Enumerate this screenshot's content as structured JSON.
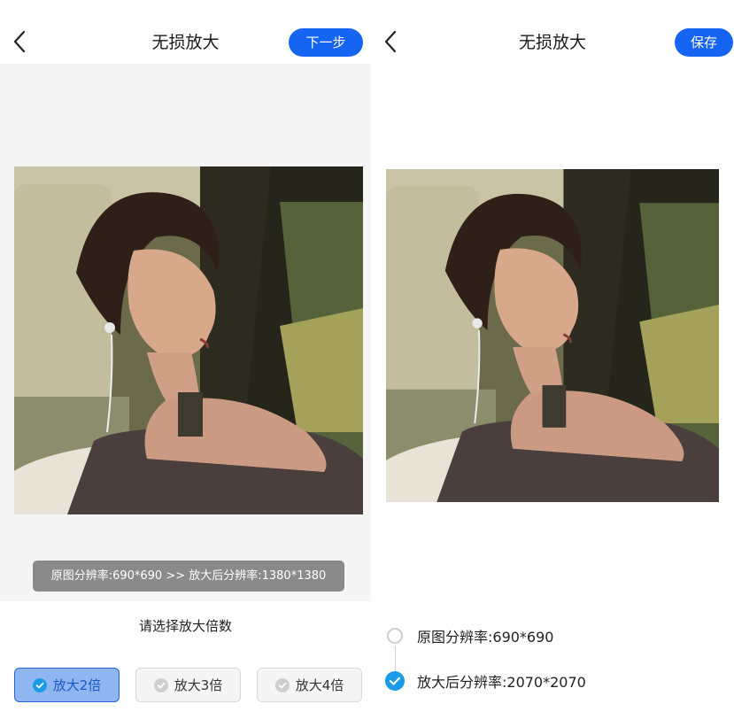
{
  "left_screen": {
    "title": "无损放大",
    "next_button": "下一步",
    "resolution_info": "原图分辨率:690*690 >> 放大后分辨率:1380*1380",
    "prompt": "请选择放大倍数",
    "scale_options": [
      {
        "label": "放大2倍",
        "selected": true
      },
      {
        "label": "放大3倍",
        "selected": false
      },
      {
        "label": "放大4倍",
        "selected": false
      }
    ]
  },
  "right_screen": {
    "title": "无损放大",
    "save_button": "保存",
    "original_resolution": "原图分辨率:690*690",
    "upscaled_resolution": "放大后分辨率:2070*2070"
  },
  "colors": {
    "accent": "#1565f2",
    "selected_option_bg": "#8fb6ee",
    "check_blue": "#1a9be8",
    "info_bar": "#8a8a8a"
  }
}
